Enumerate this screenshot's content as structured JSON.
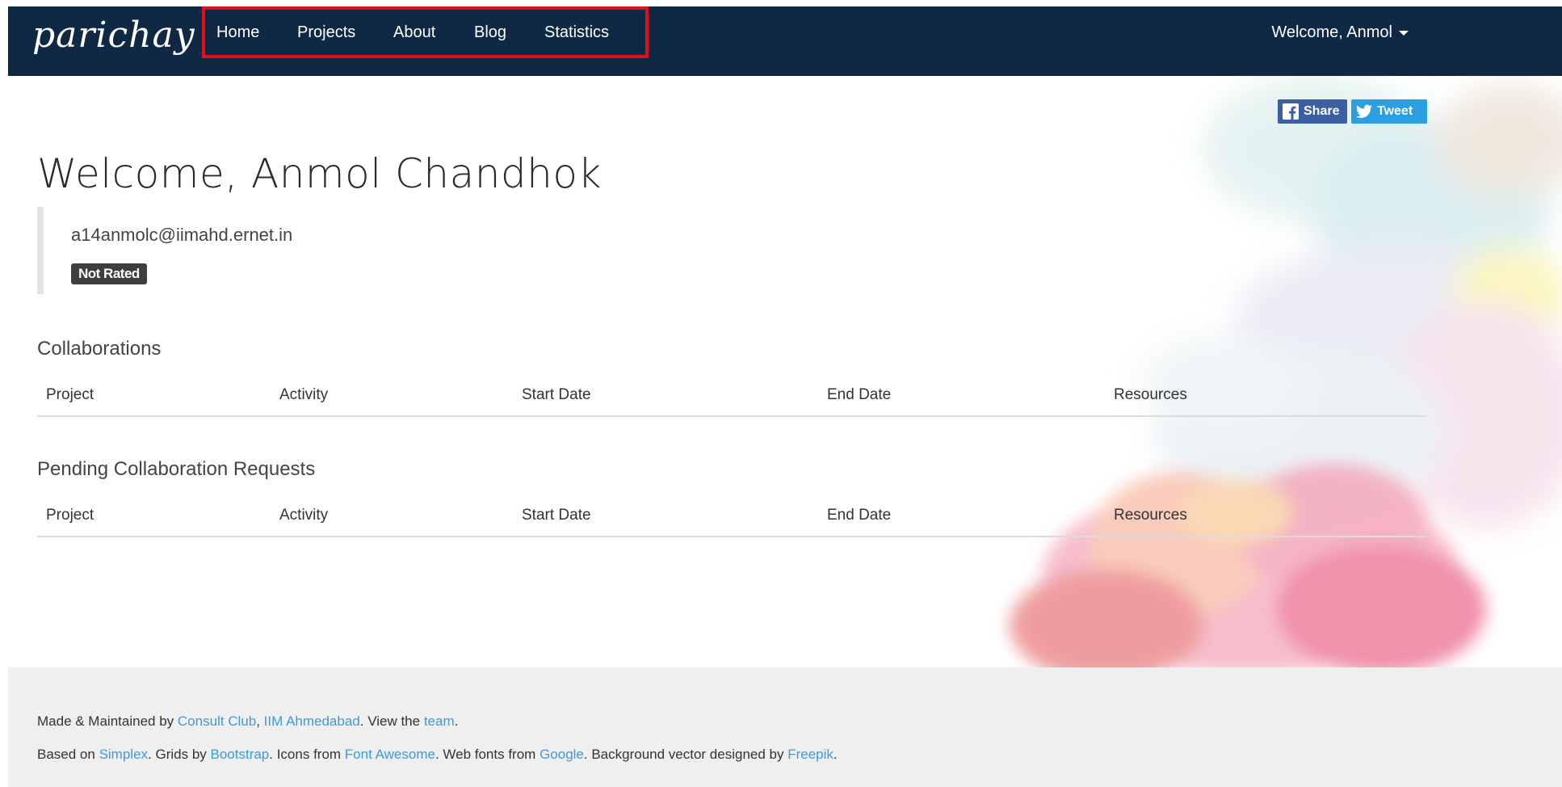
{
  "navbar": {
    "brand": "parichay",
    "items": [
      {
        "label": "Home"
      },
      {
        "label": "Projects"
      },
      {
        "label": "About"
      },
      {
        "label": "Blog"
      },
      {
        "label": "Statistics"
      }
    ],
    "user_menu": "Welcome, Anmol"
  },
  "share": {
    "facebook_label": "Share",
    "twitter_label": "Tweet"
  },
  "profile": {
    "heading": "Welcome, Anmol Chandhok",
    "email": "a14anmolc@iimahd.ernet.in",
    "rating_badge": "Not Rated"
  },
  "collaborations": {
    "title": "Collaborations",
    "columns": [
      "Project",
      "Activity",
      "Start Date",
      "End Date",
      "Resources"
    ]
  },
  "pending": {
    "title": "Pending Collaboration Requests",
    "columns": [
      "Project",
      "Activity",
      "Start Date",
      "End Date",
      "Resources"
    ]
  },
  "footer": {
    "line1": {
      "prefix": "Made & Maintained by ",
      "link1": "Consult Club",
      "sep1": ", ",
      "link2": "IIM Ahmedabad",
      "mid": ". View the ",
      "link3": "team",
      "end": "."
    },
    "line2": {
      "t1": "Based on ",
      "l1": "Simplex",
      "t2": ". Grids by ",
      "l2": "Bootstrap",
      "t3": ". Icons from ",
      "l3": "Font Awesome",
      "t4": ". Web fonts from ",
      "l4": "Google",
      "t5": ". Background vector designed by ",
      "l5": "Freepik",
      "t6": "."
    }
  },
  "colors": {
    "navbar": "#0f2945",
    "highlight": "#e3101a",
    "link": "#3f9ad6",
    "footer_bg": "#efefef",
    "badge_bg": "#3e3e3e",
    "facebook": "#3b5fa0",
    "twitter": "#2c9fe0"
  },
  "icons": [
    "facebook-icon",
    "twitter-icon",
    "caret-down-icon"
  ]
}
